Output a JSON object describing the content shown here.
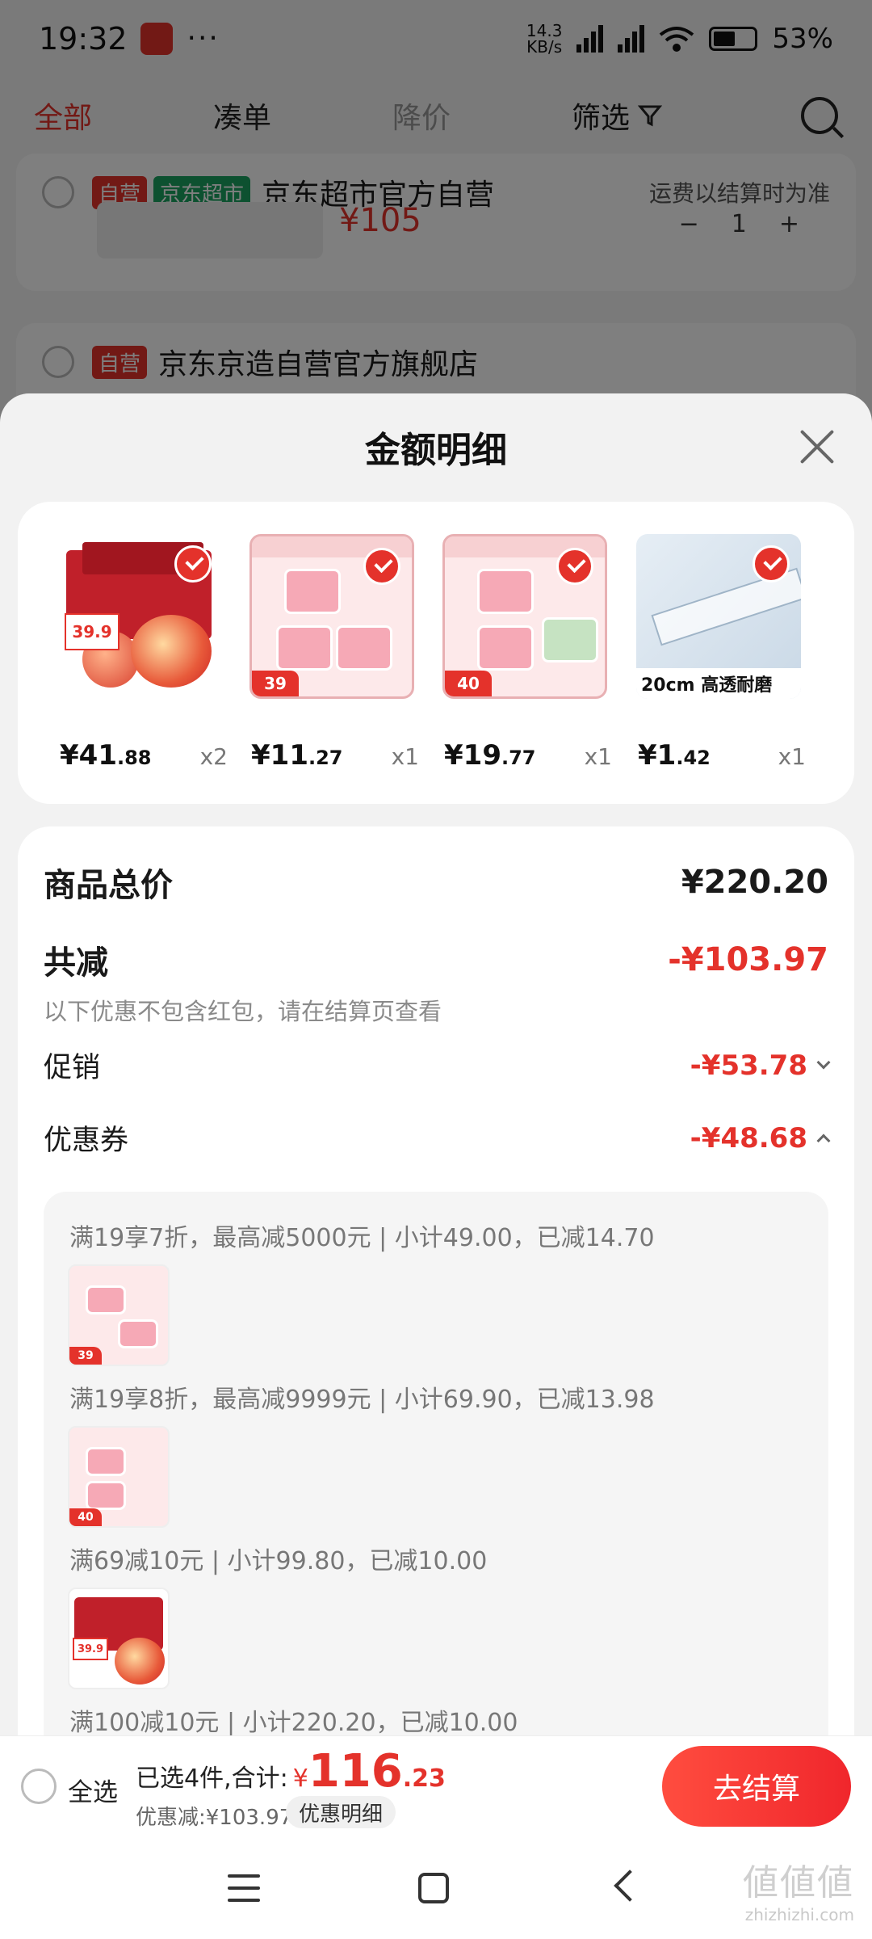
{
  "status_bar": {
    "time": "19:32",
    "more": "···",
    "net_speed_value": "14.3",
    "net_speed_unit": "KB/s",
    "battery": "53%"
  },
  "tabs": {
    "all": "全部",
    "bundle": "凑单",
    "price_drop": "降价",
    "filter": "筛选"
  },
  "background_shops": [
    {
      "tag_self": "自营",
      "tag_market": "京东超市",
      "name": "京东超市官方自营",
      "note": "运费以结算时为准",
      "price": "¥105",
      "qty": "1"
    },
    {
      "tag_self": "自营",
      "name": "京东京造自营官方旗舰店"
    }
  ],
  "sheet": {
    "title": "金额明细"
  },
  "products": [
    {
      "price_int": "¥41",
      "price_dec": ".88",
      "qty": "x2",
      "sticker": "39.9",
      "image": "apple-gift-box"
    },
    {
      "price_int": "¥11",
      "price_dec": ".27",
      "qty": "x1",
      "sticker": "39",
      "image": "liby-detergent-pods"
    },
    {
      "price_int": "¥19",
      "price_dec": ".77",
      "qty": "x1",
      "sticker": "40",
      "image": "liby-detergent-pods"
    },
    {
      "price_int": "¥1",
      "price_dec": ".42",
      "qty": "x1",
      "caption": "20cm 高透耐磨",
      "image": "deli-ruler"
    }
  ],
  "details": {
    "total_label": "商品总价",
    "total_value": "¥220.20",
    "reduce_label": "共减",
    "reduce_value": "-¥103.97",
    "reduce_note": "以下优惠不包含红包，请在结算页查看",
    "promo_label": "促销",
    "promo_value": "-¥53.78",
    "coupon_label": "优惠券",
    "coupon_value": "-¥48.68"
  },
  "coupons": [
    {
      "rule": "满19享7折，最高减5000元 | 小计49.00，已减14.70",
      "thumb_tag": "39"
    },
    {
      "rule": "满19享8折，最高减9999元 | 小计69.90，已减13.98",
      "thumb_tag": "40"
    },
    {
      "rule": "满69减10元 | 小计99.80，已减10.00",
      "thumb_tag": "39.9"
    },
    {
      "rule": "满100减10元 | 小计220.20，已减10.00"
    }
  ],
  "bottom_bar": {
    "select_all": "全选",
    "selected_prefix": "已选4件,合计:",
    "currency": "¥",
    "total_int": "116",
    "total_dec": ".23",
    "discount": "优惠减:¥103.97",
    "detail_button": "优惠明细",
    "checkout_button": "去结算"
  },
  "watermark": {
    "logo": "値値値",
    "domain": "zhizhizhi.com"
  },
  "colors": {
    "accent": "#e4322b",
    "sheet_bg": "#f2f2f2",
    "card_bg": "#ffffff"
  }
}
